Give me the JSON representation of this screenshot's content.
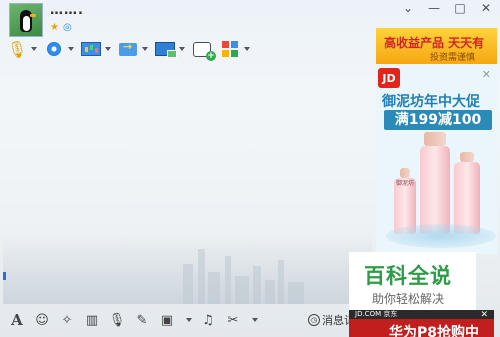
{
  "header": {
    "nickname": "……."
  },
  "window_controls": {
    "unknown": "⚙",
    "minimize": "—",
    "maximize": "□",
    "close": "✕"
  },
  "toolbar": {
    "items": [
      "voice-call",
      "video-call",
      "screen-share",
      "file-transfer",
      "remote-assist",
      "invite-group",
      "apps"
    ]
  },
  "bottom_toolbar": {
    "font_label": "A",
    "history_label": "消息记录"
  },
  "ad": {
    "top_text": "高收益产品 天天有",
    "top_sub": "投资需谨慎",
    "jd_logo": "JD",
    "title": "御泥坊年中大促",
    "promo": "满199减100",
    "bottle_brand": "御泥坊"
  },
  "watermark": {
    "title": "百科全说",
    "subtitle": "助你轻松解决"
  },
  "jd_banner": {
    "top_text": "JD.COM 京东",
    "text": "华为P8抢购中"
  },
  "colors": {
    "accent_green": "#2e9c46",
    "jd_red": "#e1251b"
  }
}
